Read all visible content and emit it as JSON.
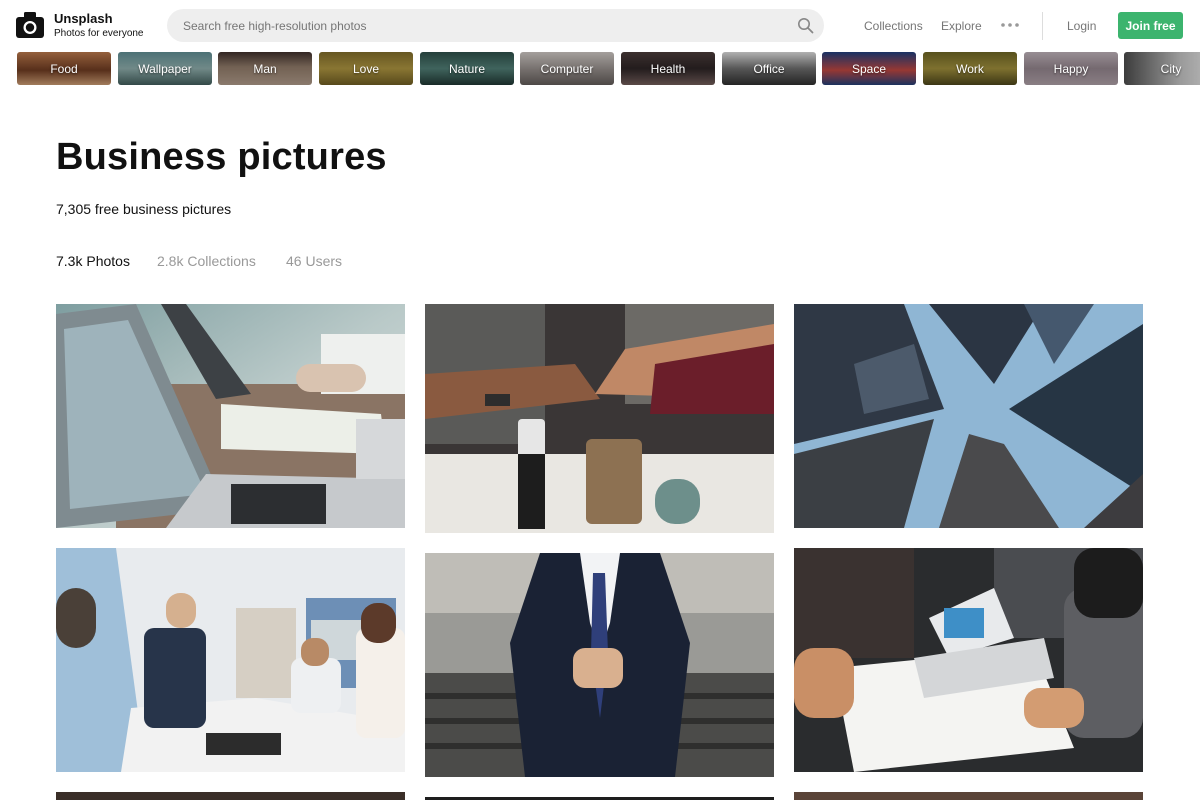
{
  "brand": {
    "name": "Unsplash",
    "tagline": "Photos for everyone"
  },
  "search": {
    "placeholder": "Search free high-resolution photos"
  },
  "nav": {
    "collections": "Collections",
    "explore": "Explore",
    "login": "Login",
    "join": "Join free"
  },
  "colors": {
    "accent": "#3cb46e",
    "search_bg": "#eeeeee"
  },
  "topics": [
    {
      "label": "Food"
    },
    {
      "label": "Wallpaper"
    },
    {
      "label": "Man"
    },
    {
      "label": "Love"
    },
    {
      "label": "Nature"
    },
    {
      "label": "Computer"
    },
    {
      "label": "Health"
    },
    {
      "label": "Office"
    },
    {
      "label": "Space"
    },
    {
      "label": "Work"
    },
    {
      "label": "Happy"
    },
    {
      "label": "City"
    }
  ],
  "page": {
    "title": "Business pictures",
    "subtitle": "7,305 free business pictures"
  },
  "tabs": [
    {
      "label": "7.3k Photos",
      "active": true
    },
    {
      "label": "2.8k Collections",
      "active": false
    },
    {
      "label": "46 Users",
      "active": false
    }
  ],
  "photos": [
    {
      "subject": "laptop-meeting"
    },
    {
      "subject": "team-fist-bump"
    },
    {
      "subject": "skyscrapers"
    },
    {
      "subject": "office-meeting"
    },
    {
      "subject": "businessman-suit"
    },
    {
      "subject": "paperwork-laptop"
    }
  ]
}
